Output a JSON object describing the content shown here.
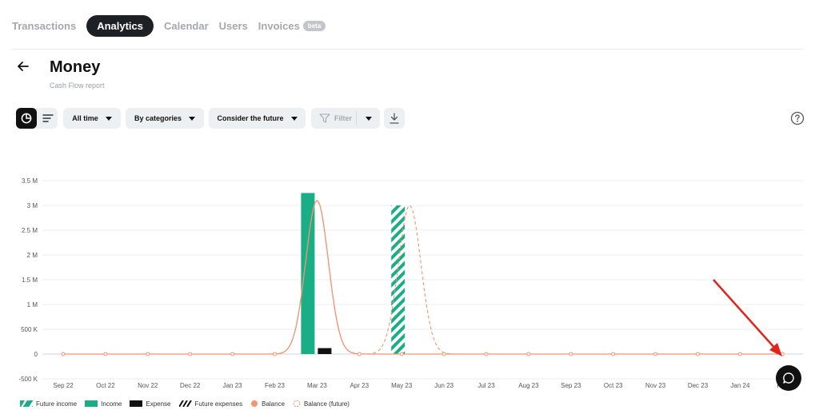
{
  "nav": {
    "tabs": [
      {
        "label": "Transactions"
      },
      {
        "label": "Analytics"
      },
      {
        "label": "Calendar"
      },
      {
        "label": "Users"
      },
      {
        "label": "Invoices"
      }
    ],
    "badge": "beta"
  },
  "header": {
    "title": "Money",
    "subtitle": "Cash Flow report"
  },
  "toolbar": {
    "period": "All time",
    "grouping": "By categories",
    "future": "Consider the future",
    "filter": "Filter"
  },
  "colors": {
    "income": "#1aae86",
    "expense": "#111111",
    "balance": "#f49272",
    "annotation_arrow": "#e3241b"
  },
  "chart_data": {
    "type": "bar",
    "categories": [
      "Sep 22",
      "Oct 22",
      "Nov 22",
      "Dec 22",
      "Jan 23",
      "Feb 23",
      "Mar 23",
      "Apr 23",
      "May 23",
      "Jun 23",
      "Jul 23",
      "Aug 23",
      "Sep 23",
      "Oct 23",
      "Nov 23",
      "Dec 23",
      "Jan 24",
      "Feb 24"
    ],
    "tick_labels": [
      "Sep 22",
      "Oct 22",
      "Nov 22",
      "Dec 22",
      "Jan 23",
      "Feb 23",
      "Mar 23",
      "Apr 23",
      "May 23",
      "Jun 23",
      "Jul 23",
      "Aug 23",
      "Sep 23",
      "Oct 23",
      "Nov 23",
      "Dec 23",
      "Jan 24",
      "Feb"
    ],
    "y_ticks": [
      {
        "value": -500000,
        "label": "-500 K"
      },
      {
        "value": 0,
        "label": "0"
      },
      {
        "value": 500000,
        "label": "500 K"
      },
      {
        "value": 1000000,
        "label": "1 M"
      },
      {
        "value": 1500000,
        "label": "1.5 M"
      },
      {
        "value": 2000000,
        "label": "2 M"
      },
      {
        "value": 2500000,
        "label": "2.5 M"
      },
      {
        "value": 3000000,
        "label": "3 M"
      },
      {
        "value": 3500000,
        "label": "3.5 M"
      }
    ],
    "ylim": [
      -500000,
      3500000
    ],
    "grid": true,
    "legend_position": "bottom-left",
    "series": [
      {
        "name": "Future income",
        "kind": "bar-hatched",
        "values": [
          0,
          0,
          0,
          0,
          0,
          0,
          0,
          0,
          3000000,
          0,
          0,
          0,
          0,
          0,
          0,
          0,
          0,
          0
        ]
      },
      {
        "name": "Income",
        "kind": "bar",
        "values": [
          0,
          0,
          0,
          0,
          0,
          0,
          3250000,
          0,
          0,
          0,
          0,
          0,
          0,
          0,
          0,
          0,
          0,
          0
        ]
      },
      {
        "name": "Expense",
        "kind": "bar",
        "values": [
          0,
          0,
          0,
          0,
          0,
          0,
          120000,
          0,
          0,
          0,
          0,
          0,
          0,
          0,
          0,
          0,
          0,
          0
        ]
      },
      {
        "name": "Future expenses",
        "kind": "bar-hatched",
        "values": [
          0,
          0,
          0,
          0,
          0,
          0,
          0,
          0,
          0,
          0,
          0,
          0,
          0,
          0,
          0,
          0,
          0,
          0
        ]
      },
      {
        "name": "Balance",
        "kind": "line",
        "values": [
          0,
          0,
          0,
          0,
          0,
          0,
          3100000,
          0,
          0,
          0,
          0,
          0,
          0,
          0,
          0,
          0,
          0,
          0
        ]
      },
      {
        "name": "Balance (future)",
        "kind": "line-dashed",
        "values": [
          0,
          0,
          0,
          0,
          0,
          0,
          3100000,
          0,
          3000000,
          0,
          0,
          0,
          0,
          0,
          0,
          0,
          0,
          0
        ]
      }
    ]
  }
}
